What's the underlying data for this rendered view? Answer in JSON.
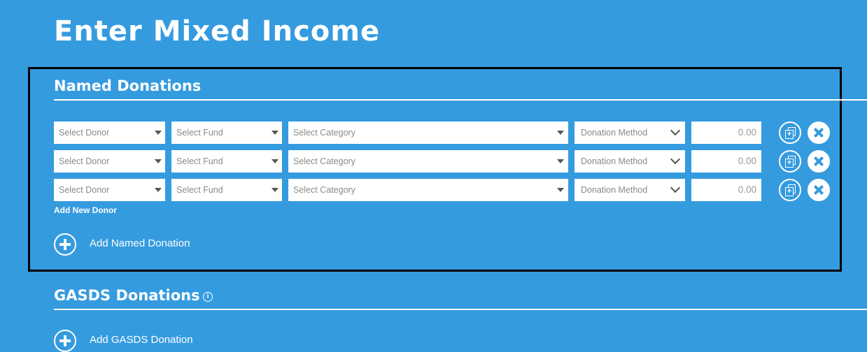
{
  "page": {
    "title": "Enter Mixed Income"
  },
  "named_donations": {
    "title": "Named Donations",
    "rows": [
      {
        "donor": "Select Donor",
        "fund": "Select Fund",
        "category": "Select Category",
        "method": "Donation Method",
        "amount": "0.00"
      },
      {
        "donor": "Select Donor",
        "fund": "Select Fund",
        "category": "Select Category",
        "method": "Donation Method",
        "amount": "0.00"
      },
      {
        "donor": "Select Donor",
        "fund": "Select Fund",
        "category": "Select Category",
        "method": "Donation Method",
        "amount": "0.00"
      }
    ],
    "add_new_donor": "Add New Donor",
    "add_label": "Add Named Donation"
  },
  "gasds_donations": {
    "title": "GASDS Donations",
    "info_glyph": "i",
    "add_label": "Add GASDS Donation"
  },
  "icons": {
    "row_copy": "copy-plus-icon",
    "row_remove": "close-icon",
    "add": "plus-circle-icon",
    "info": "info-icon"
  },
  "colors": {
    "background": "#359bdf",
    "text": "#ffffff",
    "highlight_border": "#000000",
    "field_bg": "#ffffff",
    "placeholder": "#8a8a8a"
  }
}
